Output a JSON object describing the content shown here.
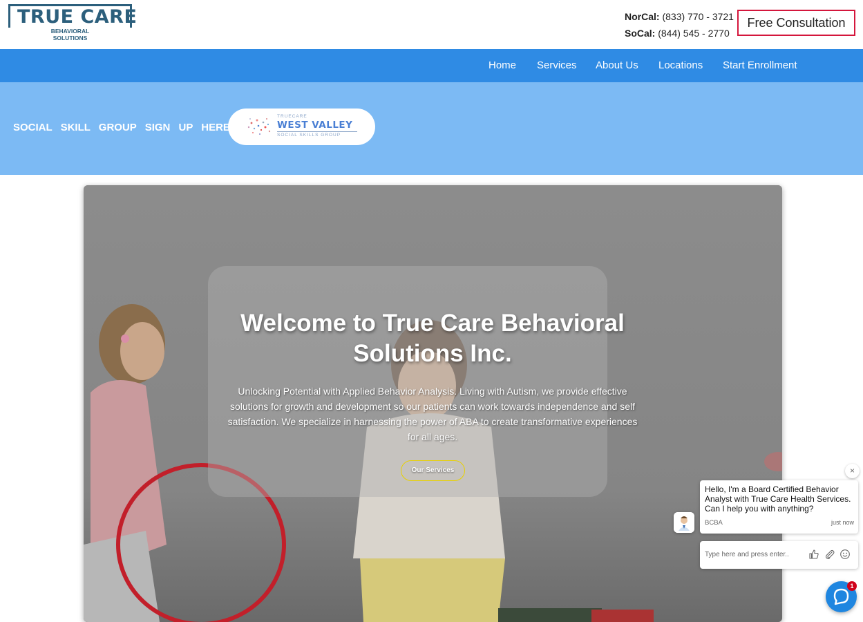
{
  "header": {
    "logo": {
      "main_text": "TRUE CARE",
      "sub_line1": "BEHAVIORAL",
      "sub_line2": "SOLUTIONS",
      "color": "#2c5f7c"
    },
    "phones": {
      "norcal_label": "NorCal:",
      "norcal_number": "(833) 770 - 3721",
      "socal_label": "SoCal:",
      "socal_number": "(844) 545 - 2770"
    },
    "consult_button": "Free Consultation",
    "consult_border_color": "#d4163c"
  },
  "nav": {
    "background": "#2f8be4",
    "items": [
      "Home",
      "Services",
      "About Us",
      "Locations",
      "Start Enrollment"
    ]
  },
  "banner": {
    "background": "#7cbaf4",
    "text": "SOCIAL SKILL GROUP SIGN UP HERE:",
    "west_valley": {
      "top": "TRUECARE",
      "main": "WEST VALLEY",
      "bottom": "SOCIAL SKILLS GROUP"
    }
  },
  "hero": {
    "title": "Welcome to True Care Behavioral Solutions Inc.",
    "description": "Unlocking Potential with Applied Behavior Analysis. Living with Autism, we provide effective solutions for growth and development so our patients can work towards independence and self satisfaction. We specialize in harnessing the power of ABA to create transformative experiences for all ages.",
    "button": "Our Services",
    "button_border_color": "#e8d100"
  },
  "chat": {
    "close_icon": "×",
    "message": "Hello, I'm a Board Certified Behavior Analyst with True Care Health Services. Can I help you with anything?",
    "sender": "BCBA",
    "time": "just now",
    "input_placeholder": "Type here and press enter..",
    "badge_count": "1",
    "accent": "#1f86e0"
  }
}
